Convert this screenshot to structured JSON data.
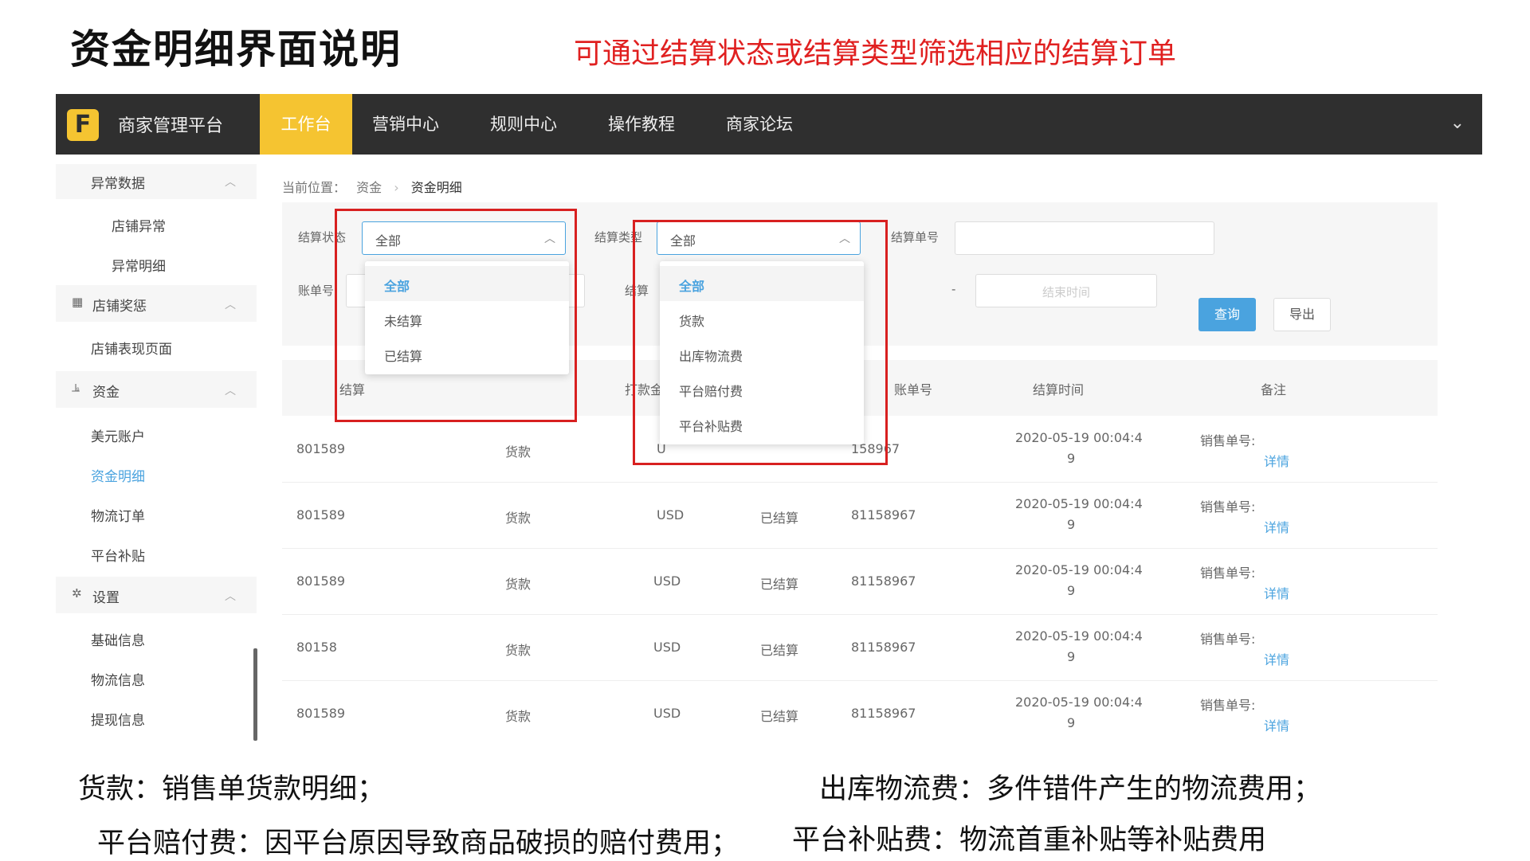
{
  "title": "资金明细界面说明",
  "note": "可通过结算状态或结算类型筛选相应的结算订单",
  "app": {
    "logo_letter": "F",
    "brand": "商家管理平台",
    "nav": [
      "工作台",
      "营销中心",
      "规则中心",
      "操作教程",
      "商家论坛"
    ],
    "nav_active": 0
  },
  "sidebar": {
    "sections": [
      {
        "label": "异常数据",
        "icon": "",
        "items": [
          "店铺异常",
          "异常明细"
        ]
      },
      {
        "label": "店铺奖惩",
        "icon": "shop-icon",
        "items": [
          "店铺表现页面"
        ]
      },
      {
        "label": "资金",
        "icon": "money-icon",
        "items": [
          "美元账户",
          "资金明细",
          "物流订单",
          "平台补贴"
        ]
      },
      {
        "label": "设置",
        "icon": "gear-icon",
        "items": [
          "基础信息",
          "物流信息",
          "提现信息"
        ]
      }
    ],
    "active_item": "资金明细"
  },
  "breadcrumb": {
    "prefix": "当前位置：",
    "level1": "资金",
    "sep": "›",
    "current": "资金明细"
  },
  "filters": {
    "status_label": "结算状态",
    "status_value": "全部",
    "type_label": "结算类型",
    "type_value": "全部",
    "order_label": "结算单号",
    "bill_label": "账单号",
    "row2_label2": "结算",
    "date_dash": "-",
    "date_end_placeholder": "结束时间",
    "query": "查询",
    "export": "导出"
  },
  "status_dropdown": [
    "全部",
    "未结算",
    "已结算"
  ],
  "type_dropdown": [
    "全部",
    "货款",
    "出库物流费",
    "平台赔付费",
    "平台补贴费"
  ],
  "table": {
    "headers": [
      "结算",
      "打款金",
      "账单号",
      "结算时间",
      "备注"
    ],
    "rows": [
      {
        "id": "801589",
        "type": "货款",
        "cur": "U",
        "status": "",
        "bill": "158967",
        "time1": "2020-05-19 00:04:4",
        "time2": "9",
        "note": "销售单号:",
        "link": "详情"
      },
      {
        "id": "801589",
        "type": "货款",
        "cur": "USD",
        "status": "已结算",
        "bill": "81158967",
        "time1": "2020-05-19 00:04:4",
        "time2": "9",
        "note": "销售单号:",
        "link": "详情"
      },
      {
        "id": "801589",
        "type": "货款",
        "cur": "USD",
        "status": "已结算",
        "bill": "81158967",
        "time1": "2020-05-19 00:04:4",
        "time2": "9",
        "note": "销售单号:",
        "link": "详情"
      },
      {
        "id": "80158",
        "type": "货款",
        "cur": "USD",
        "status": "已结算",
        "bill": "81158967",
        "time1": "2020-05-19 00:04:4",
        "time2": "9",
        "note": "销售单号:",
        "link": "详情"
      },
      {
        "id": "801589",
        "type": "货款",
        "cur": "USD",
        "status": "已结算",
        "bill": "81158967",
        "time1": "2020-05-19 00:04:4",
        "time2": "9",
        "note": "销售单号:",
        "link": "详情"
      }
    ]
  },
  "footnotes": [
    "货款：销售单货款明细；",
    "出库物流费：多件错件产生的物流费用；",
    "平台赔付费：因平台原因导致商品破损的赔付费用；",
    "平台补贴费：物流首重补贴等补贴费用"
  ]
}
